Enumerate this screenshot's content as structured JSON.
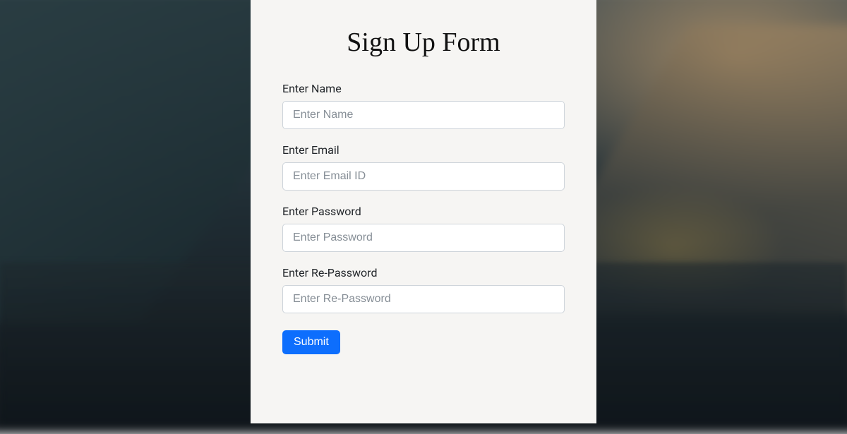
{
  "form": {
    "title": "Sign Up Form",
    "fields": {
      "name": {
        "label": "Enter Name",
        "placeholder": "Enter Name"
      },
      "email": {
        "label": "Enter Email",
        "placeholder": "Enter Email ID"
      },
      "password": {
        "label": "Enter Password",
        "placeholder": "Enter Password"
      },
      "repassword": {
        "label": "Enter Re-Password",
        "placeholder": "Enter Re-Password"
      }
    },
    "submit_label": "Submit"
  }
}
